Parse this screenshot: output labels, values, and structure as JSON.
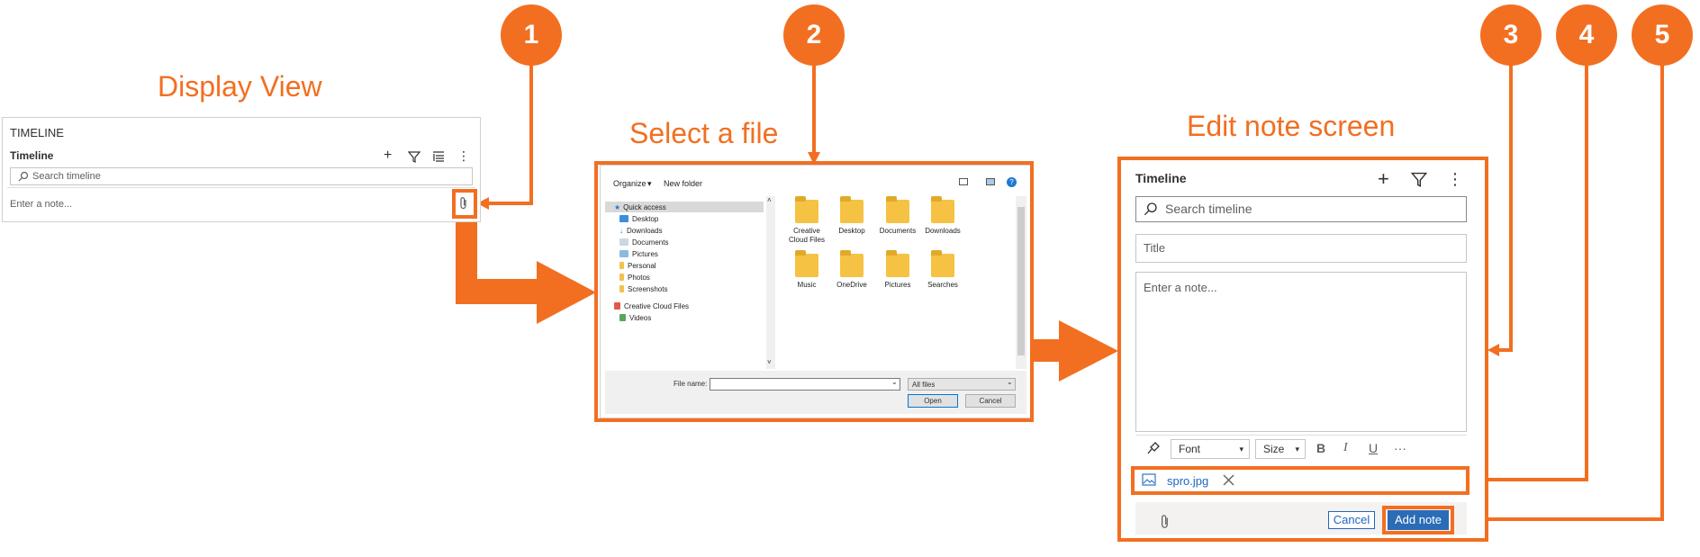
{
  "headings": {
    "display_view": "Display View",
    "select_file": "Select a file",
    "edit_note": "Edit note screen"
  },
  "callouts": [
    "1",
    "2",
    "3",
    "4",
    "5"
  ],
  "display_view": {
    "section_title": "TIMELINE",
    "timeline_label": "Timeline",
    "search_placeholder": "Search timeline",
    "note_placeholder": "Enter a note..."
  },
  "file_dialog": {
    "toolbar": {
      "organize": "Organize",
      "new_folder": "New folder"
    },
    "nav_items": [
      "Quick access",
      "Desktop",
      "Downloads",
      "Documents",
      "Pictures",
      "Personal",
      "Photos",
      "Screenshots",
      "Creative Cloud Files",
      "Videos"
    ],
    "folders": [
      "Creative Cloud Files",
      "Desktop",
      "Documents",
      "Downloads",
      "Music",
      "OneDrive",
      "Pictures",
      "Searches"
    ],
    "file_name_label": "File name:",
    "file_name_value": "",
    "file_type": "All files",
    "open_label": "Open",
    "cancel_label": "Cancel"
  },
  "edit_note": {
    "timeline_label": "Timeline",
    "search_placeholder": "Search timeline",
    "title_placeholder": "Title",
    "note_placeholder": "Enter a note...",
    "font_label": "Font",
    "size_label": "Size",
    "bold": "B",
    "italic": "I",
    "underline": "U",
    "more": "···",
    "attachment_name": "spro.jpg",
    "cancel_label": "Cancel",
    "add_note_label": "Add note"
  },
  "colors": {
    "accent": "#f26f21",
    "primary_button": "#2b6cb6",
    "link": "#2266c0"
  }
}
